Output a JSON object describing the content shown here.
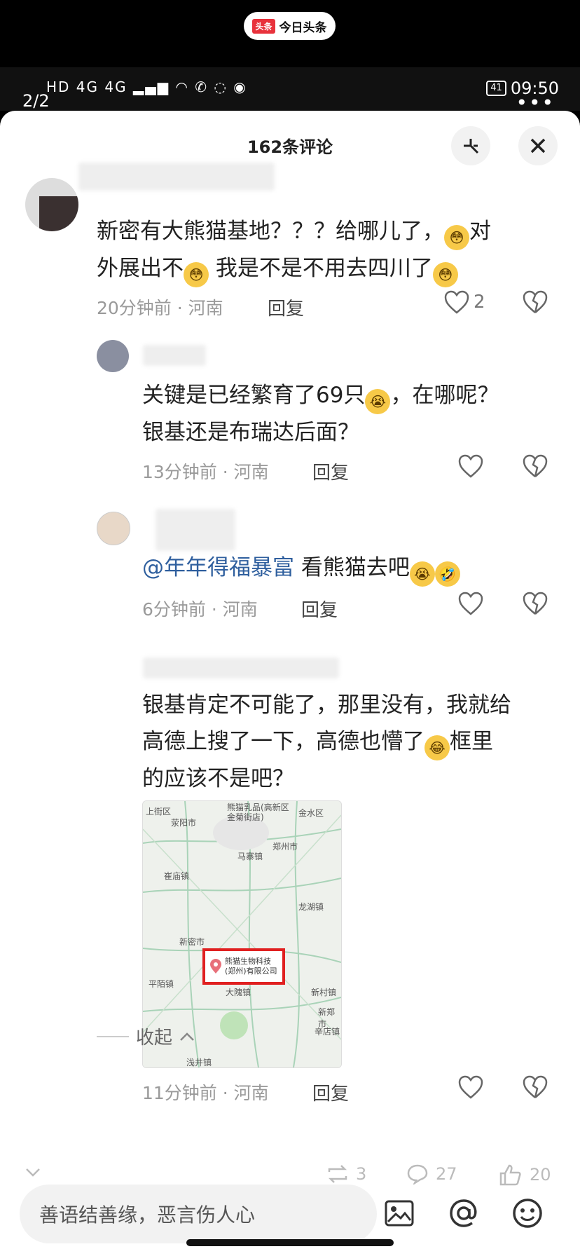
{
  "app_pill": {
    "logo": "头条",
    "name": "今日头条"
  },
  "status": {
    "page_indicator": "2/2",
    "signal_text": "HD 4G 4G",
    "battery": "41",
    "time": "09:50",
    "more": "•••"
  },
  "sheet": {
    "title": "162条评论"
  },
  "comments": [
    {
      "text_line1": "新密有大熊猫基地？？？给哪儿了，",
      "text_line1b": "对",
      "text_line2a": "外展出不",
      "text_line2b": " 我是不是不用去四川了",
      "time": "20分钟前 · 河南",
      "reply": "回复",
      "likes": "2"
    },
    {
      "text_line1": "关键是已经繁育了69只",
      "text_line1b": "，在哪呢？",
      "text_line2": "银基还是布瑞达后面？",
      "time": "13分钟前 · 河南",
      "reply": "回复"
    },
    {
      "mention": "@年年得福暴富",
      "text": " 看熊猫去吧",
      "time": "6分钟前 · 河南",
      "reply": "回复"
    },
    {
      "text_line1": "银基肯定不可能了，那里没有，我就给",
      "text_line2": "高德上搜了一下，高德也懵了",
      "text_line2b": "框里",
      "text_line3": "的应该不是吧？",
      "time": "11分钟前 · 河南",
      "reply": "回复"
    }
  ],
  "map": {
    "labels": {
      "a": "上街区",
      "b": "荥阳市",
      "c": "金水区",
      "d": "郑州市",
      "e": "马寨镇",
      "f": "崔庙镇",
      "g": "龙湖镇",
      "h": "新密市",
      "i": "平陌镇",
      "j": "大隗镇",
      "k": "新村镇",
      "l": "新郑市",
      "m": "辛店镇",
      "n": "浅井镇",
      "o": "熊猫乳品(高新区金菊街店)"
    },
    "highlight": "熊猫生物科技(郑州)有限公司"
  },
  "collapse_label": "收起",
  "stats": {
    "reposts": "3",
    "comments": "27",
    "likes": "20"
  },
  "input": {
    "placeholder": "善语结善缘，恶言伤人心"
  },
  "colors": {
    "accent": "#e8323c",
    "mention": "#2f5f9e",
    "highlight_box": "#e02020"
  }
}
